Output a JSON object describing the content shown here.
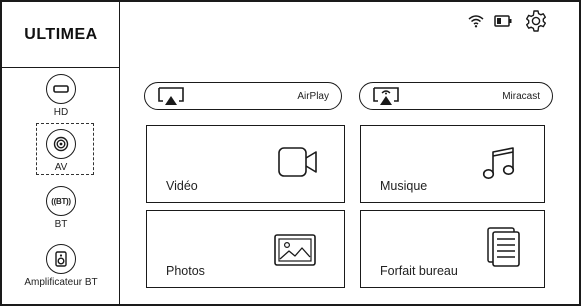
{
  "brand": {
    "logo": "ULTIMEA"
  },
  "sources": [
    {
      "label": "HD",
      "icon": "hdmi-port-icon"
    },
    {
      "label": "AV",
      "icon": "av-port-icon",
      "selected": true
    },
    {
      "label": "BT",
      "icon": "bluetooth-badge-icon",
      "badge": "((BT))"
    },
    {
      "label": "Amplificateur BT",
      "icon": "speaker-icon"
    }
  ],
  "status": {
    "icons": [
      "wifi-icon",
      "battery-icon",
      "gear-icon"
    ]
  },
  "cast": [
    {
      "label": "AirPlay",
      "icon": "airplay-icon"
    },
    {
      "label": "Miracast",
      "icon": "miracast-icon"
    }
  ],
  "tiles": [
    {
      "label": "Vidéo",
      "icon": "video-camera-icon"
    },
    {
      "label": "Musique",
      "icon": "music-note-icon"
    },
    {
      "label": "Photos",
      "icon": "photo-icon"
    },
    {
      "label": "Forfait bureau",
      "icon": "document-icon"
    }
  ],
  "colors": {
    "line": "#1a1a1a",
    "background": "#ffffff"
  }
}
